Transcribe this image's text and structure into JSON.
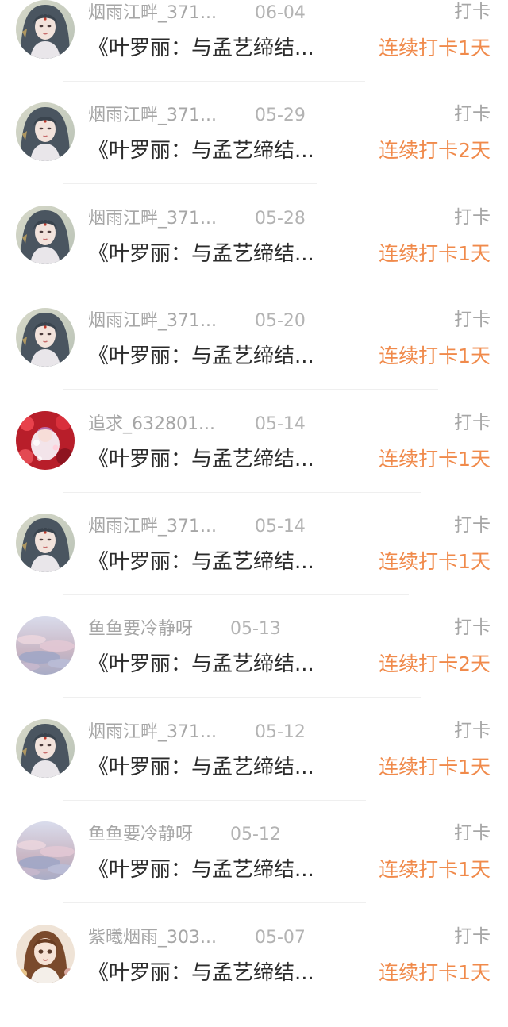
{
  "colors": {
    "accent": "#f08a4b",
    "username": "#a6a6a6",
    "content": "#2b2b2b"
  },
  "feed": {
    "items": [
      {
        "avatar": "ancient-girl-avatar-icon",
        "username": "烟雨江畔_371...",
        "date": "06-04",
        "action": "打卡",
        "content": "《叶罗丽：与孟艺缔结...",
        "streak": "连续打卡1天"
      },
      {
        "avatar": "ancient-girl-avatar-icon",
        "username": "烟雨江畔_371...",
        "date": "05-29",
        "action": "打卡",
        "content": "《叶罗丽：与孟艺缔结...",
        "streak": "连续打卡2天"
      },
      {
        "avatar": "ancient-girl-avatar-icon",
        "username": "烟雨江畔_371...",
        "date": "05-28",
        "action": "打卡",
        "content": "《叶罗丽：与孟艺缔结...",
        "streak": "连续打卡1天"
      },
      {
        "avatar": "ancient-girl-avatar-icon",
        "username": "烟雨江畔_371...",
        "date": "05-20",
        "action": "打卡",
        "content": "《叶罗丽：与孟艺缔结...",
        "streak": "连续打卡1天"
      },
      {
        "avatar": "red-flowers-avatar-icon",
        "username": "追求_632801...",
        "date": "05-14",
        "action": "打卡",
        "content": "《叶罗丽：与孟艺缔结...",
        "streak": "连续打卡1天"
      },
      {
        "avatar": "ancient-girl-avatar-icon",
        "username": "烟雨江畔_371...",
        "date": "05-14",
        "action": "打卡",
        "content": "《叶罗丽：与孟艺缔结...",
        "streak": "连续打卡1天"
      },
      {
        "avatar": "cloudy-sky-avatar-icon",
        "username": "鱼鱼要冷静呀",
        "date": "05-13",
        "action": "打卡",
        "content": "《叶罗丽：与孟艺缔结...",
        "streak": "连续打卡2天"
      },
      {
        "avatar": "ancient-girl-avatar-icon",
        "username": "烟雨江畔_371...",
        "date": "05-12",
        "action": "打卡",
        "content": "《叶罗丽：与孟艺缔结...",
        "streak": "连续打卡1天"
      },
      {
        "avatar": "cloudy-sky-avatar-icon",
        "username": "鱼鱼要冷静呀",
        "date": "05-12",
        "action": "打卡",
        "content": "《叶罗丽：与孟艺缔结...",
        "streak": "连续打卡1天"
      },
      {
        "avatar": "brown-hair-girl-avatar-icon",
        "username": "紫曦烟雨_303...",
        "date": "05-07",
        "action": "打卡",
        "content": "《叶罗丽：与孟艺缔结...",
        "streak": "连续打卡1天"
      }
    ]
  }
}
